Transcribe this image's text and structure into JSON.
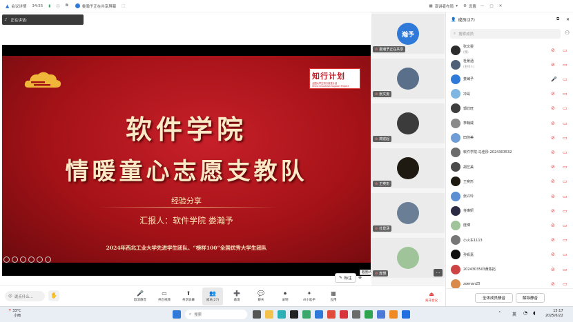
{
  "topbar": {
    "app_name": "会议详情",
    "duration": "34:55",
    "sharing_notice": "娄瀚予正在共享屏幕",
    "view_label": "演讲者布局",
    "settings_label": "设置"
  },
  "speaking": {
    "label": "正在讲话:"
  },
  "slide": {
    "logo_title": "知行计划",
    "logo_subtitle": "全国大学生知行促进计划",
    "logo_en": "China Education Support Project",
    "title_line1": "软件学院",
    "title_line2": "情暖童心志愿支教队",
    "subtitle": "经验分享",
    "reporter": "汇报人：软件学院 娄瀚予",
    "footer": "2024年西北工业大学先进学生团队、“榜样100”全国优秀大学生团队"
  },
  "annotation": {
    "label": "标注",
    "shortcut": "截图(Alt + A)"
  },
  "videos": [
    {
      "name": "娄瀚予正在共享",
      "avatar_text": "瀚予",
      "color": "#2f79d9"
    },
    {
      "name": "张文雯",
      "avatar_text": "",
      "color": "#5a6f8a"
    },
    {
      "name": "简宏起",
      "avatar_text": "",
      "color": "#3b3b3b"
    },
    {
      "name": "王奕形",
      "avatar_text": "",
      "color": "#1e1a12"
    },
    {
      "name": "杜景涵",
      "avatar_text": "",
      "color": "#6a7f96"
    },
    {
      "name": "庞博",
      "avatar_text": "",
      "color": "#9fc49a"
    }
  ],
  "toolbar": {
    "chat_placeholder": "说点什么...",
    "buttons": [
      {
        "label": "取消静音",
        "icon": "mic-off-icon"
      },
      {
        "label": "开启视频",
        "icon": "camera-off-icon"
      },
      {
        "label": "共享屏幕",
        "icon": "share-screen-icon"
      },
      {
        "label": "成员(27)",
        "icon": "members-icon"
      },
      {
        "label": "邀请",
        "icon": "invite-icon"
      },
      {
        "label": "聊天",
        "icon": "chat-icon"
      },
      {
        "label": "录制",
        "icon": "record-icon"
      },
      {
        "label": "AI小助手",
        "icon": "ai-assistant-icon"
      },
      {
        "label": "应用",
        "icon": "apps-icon"
      }
    ],
    "end_label": "离开会议"
  },
  "panel": {
    "title": "成员(27)",
    "search_placeholder": "搜索成员",
    "members": [
      {
        "name": "张文雯",
        "tag": "(我)",
        "color": "#2c2c2c"
      },
      {
        "name": "杜景涵",
        "tag": "(主持人)",
        "color": "#4d6077"
      },
      {
        "name": "娄瀚予",
        "tag": "",
        "color": "#2f79d9"
      },
      {
        "name": "冲哥",
        "tag": "",
        "color": "#7fb7e2"
      },
      {
        "name": "郭欣旺",
        "tag": "",
        "color": "#3d3d3d"
      },
      {
        "name": "李翰威",
        "tag": "",
        "color": "#8a8a8a"
      },
      {
        "name": "田佳美",
        "tag": "",
        "color": "#6f9ed6"
      },
      {
        "name": "软件学院-马佳彤-2024303532",
        "tag": "",
        "color": "#6b6b6b"
      },
      {
        "name": "胡艺美",
        "tag": "",
        "color": "#4a4a4a"
      },
      {
        "name": "王奕形",
        "tag": "",
        "color": "#1e1a12"
      },
      {
        "name": "张兴玲",
        "tag": "",
        "color": "#5b8fd1"
      },
      {
        "name": "任琳妍",
        "tag": "",
        "color": "#2b2b44"
      },
      {
        "name": "庞博",
        "tag": "",
        "color": "#9fc49a"
      },
      {
        "name": "小火车1113",
        "tag": "",
        "color": "#777"
      },
      {
        "name": "孙钒嘉",
        "tag": "",
        "color": "#111"
      },
      {
        "name": "2024303503黄陈拓",
        "tag": "",
        "color": "#c44"
      },
      {
        "name": "zoenan25",
        "tag": "",
        "color": "#d98a4b"
      }
    ],
    "mute_all": "全体成员静音",
    "unmute_all": "解除静音"
  },
  "taskbar": {
    "weather_temp": "33°C",
    "weather_text": "小雨",
    "search_placeholder": "搜索",
    "lang": "英",
    "time": "15:17",
    "date": "2025/6/22"
  }
}
